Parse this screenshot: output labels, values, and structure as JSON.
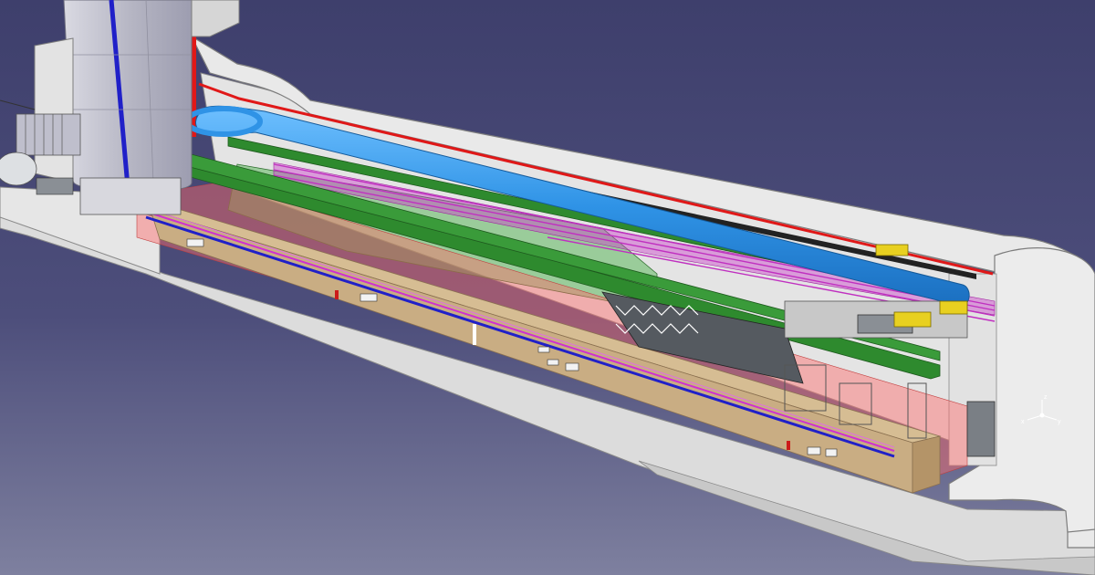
{
  "viewport": {
    "background_top": "#3e3f6c",
    "background_bottom": "#7e809f"
  },
  "compass": {
    "x_label": "x",
    "y_label": "y",
    "z_label": "z"
  },
  "colors": {
    "concrete": "#e8e8e8",
    "concrete_shadow": "#c4c4c4",
    "red_line": "#e01818",
    "blue_pipe": "#2f93e6",
    "dark_blue_line": "#2020c8",
    "magenta_line": "#d030d0",
    "green_beam": "#2e8a2e",
    "wood_panel": "#c9ad83",
    "yellow_equipment": "#e8d020"
  }
}
